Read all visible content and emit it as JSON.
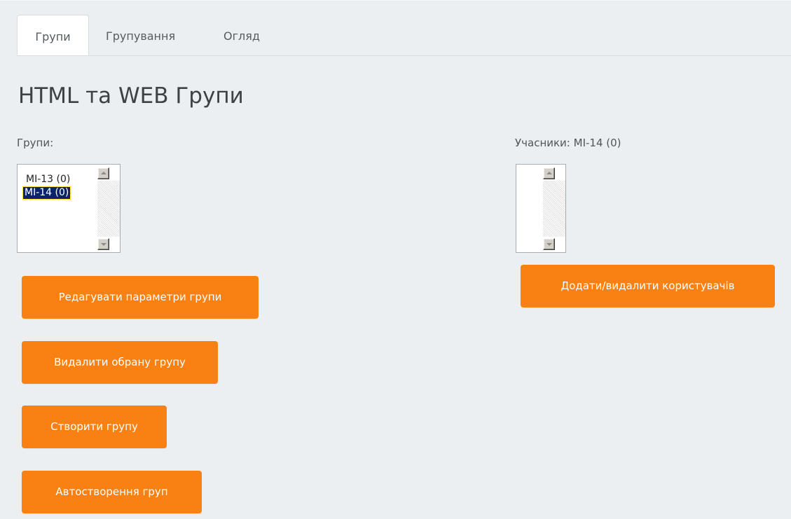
{
  "tabs": [
    {
      "label": "Групи",
      "active": true
    },
    {
      "label": "Групування",
      "active": false
    },
    {
      "label": "Огляд",
      "active": false
    }
  ],
  "page": {
    "title": "HTML та WEB Групи"
  },
  "groups_panel": {
    "label": "Групи:",
    "options": [
      {
        "label": "MI-13 (0)",
        "selected": false
      },
      {
        "label": "MI-14 (0)",
        "selected": true
      }
    ]
  },
  "members_panel": {
    "label": "Учасники: MI-14 (0)",
    "options": []
  },
  "buttons": {
    "edit_group": "Редагувати параметри групи",
    "delete_group": "Видалити обрану групу",
    "create_group": "Створити групу",
    "auto_create": "Автостворення груп",
    "add_remove_users": "Додати/видалити користувачів"
  },
  "colors": {
    "accent": "#f98012",
    "background": "#eceff1",
    "selection": "#0a246a"
  }
}
